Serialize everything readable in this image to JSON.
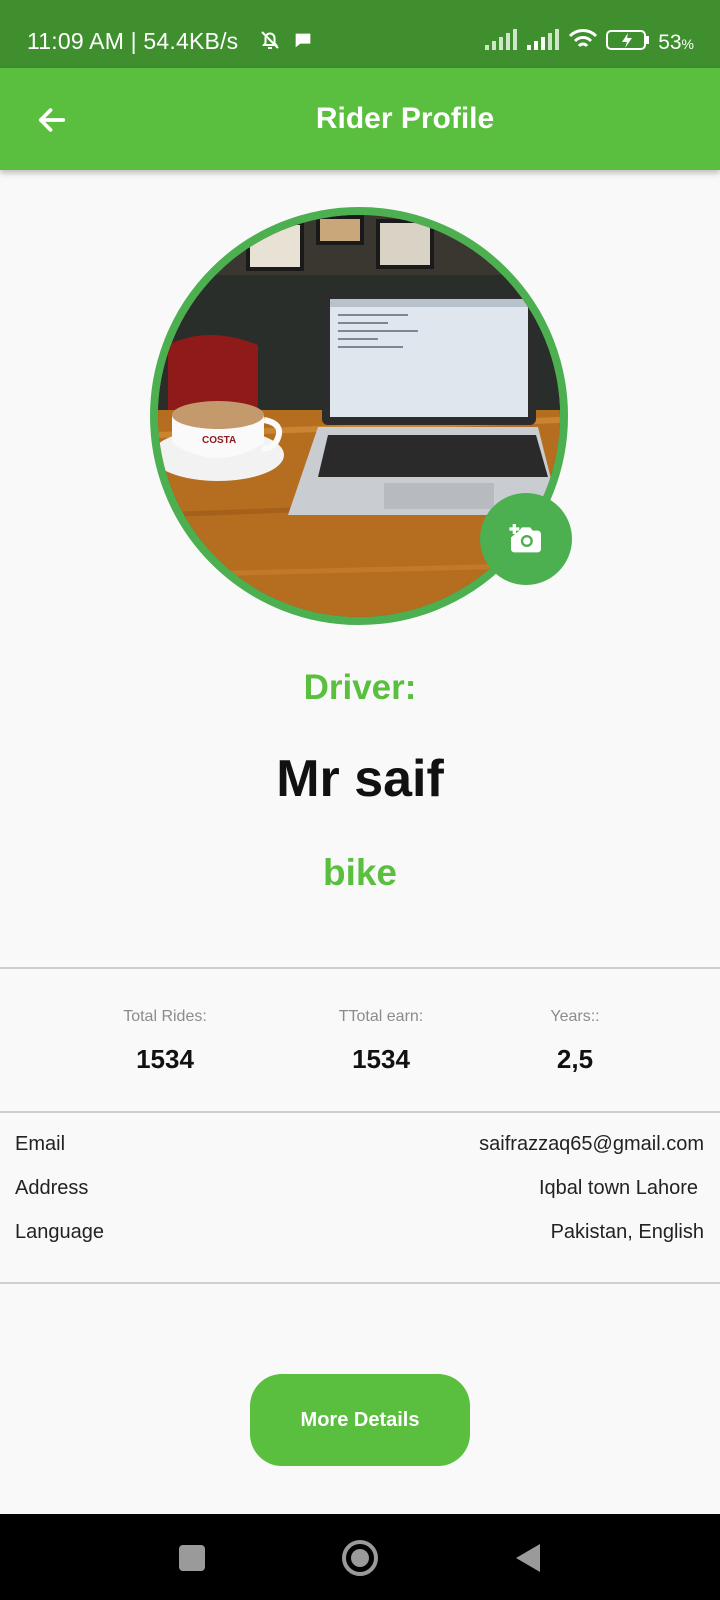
{
  "status_bar": {
    "time_speed": "11:09 AM | 54.4KB/s",
    "battery": "53",
    "battery_unit": "%",
    "icons": [
      "bell-off-icon",
      "chat-icon",
      "signal-icon",
      "signal-icon",
      "wifi-icon",
      "battery-charging-icon"
    ]
  },
  "app_bar": {
    "title": "Rider Profile",
    "back_icon": "arrow-left-icon"
  },
  "profile": {
    "role_label": "Driver:",
    "name": "Mr saif",
    "vehicle": "bike",
    "camera_icon": "add-photo-icon"
  },
  "stats": [
    {
      "label": "Total Rides:",
      "value": "1534"
    },
    {
      "label": "TTotal earn:",
      "value": "1534"
    },
    {
      "label": "Years::",
      "value": "2,5"
    }
  ],
  "info": [
    {
      "label": "Email",
      "value": "saifrazzaq65@gmail.com"
    },
    {
      "label": "Address",
      "value": "Iqbal town Lahore"
    },
    {
      "label": "Language",
      "value": "Pakistan, English"
    }
  ],
  "actions": {
    "more_details": "More Details"
  },
  "nav_bar": {
    "items": [
      "square-icon",
      "circle-icon",
      "triangle-back-icon"
    ]
  },
  "colors": {
    "status_bar": "#3f8f2f",
    "app_bar": "#5abe3f",
    "accent": "#4caf50",
    "background": "#f9f9f9"
  }
}
